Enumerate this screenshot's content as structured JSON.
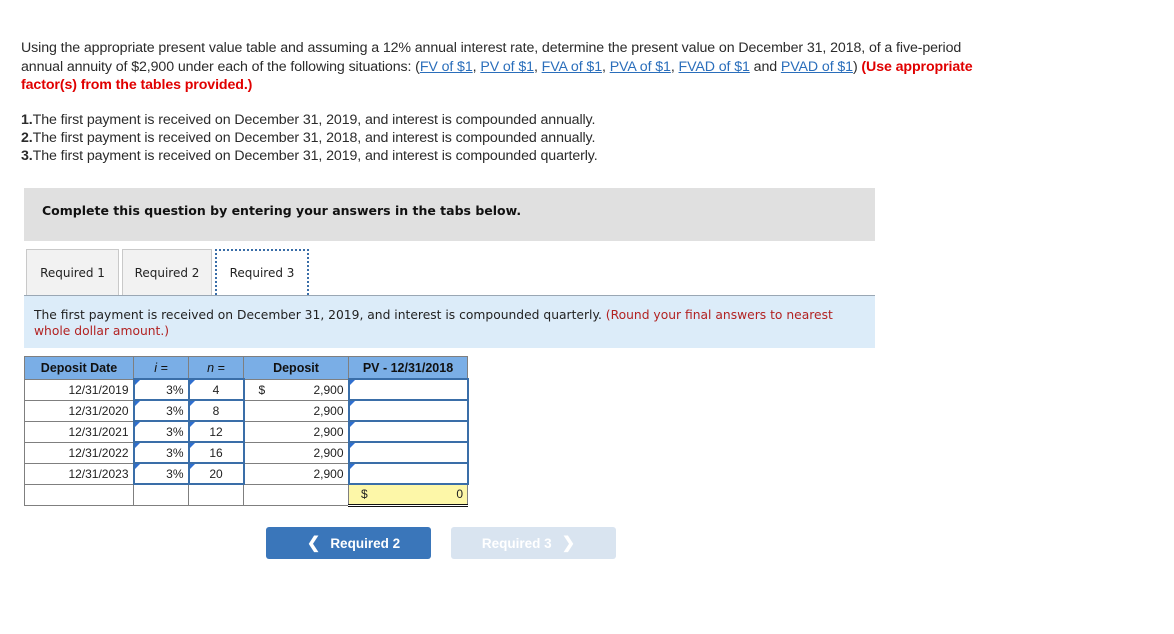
{
  "intro": {
    "text_before_links": "Using the appropriate present value table and assuming a 12% annual interest rate, determine the present value on December 31, 2018, of a five-period annual annuity of $2,900 under each of the following situations: (",
    "links": [
      "FV of $1",
      "PV of $1",
      "FVA of $1",
      "PVA of $1",
      "FVAD of $1",
      "PVAD of $1"
    ],
    "link_sep": ", ",
    "last_link_sep": " and ",
    "text_after_links": ")",
    "instruction": "(Use appropriate factor(s) from the tables provided.)"
  },
  "situations": [
    {
      "num": "1.",
      "text": "The first payment is received on December 31, 2019, and interest is compounded annually."
    },
    {
      "num": "2.",
      "text": "The first payment is received on December 31, 2018, and interest is compounded annually."
    },
    {
      "num": "3.",
      "text": "The first payment is received on December 31, 2019, and interest is compounded quarterly."
    }
  ],
  "banner": "Complete this question by entering your answers in the tabs below.",
  "tabs": [
    {
      "label": "Required 1",
      "active": false
    },
    {
      "label": "Required 2",
      "active": false
    },
    {
      "label": "Required 3",
      "active": true
    }
  ],
  "instruction_panel": {
    "text": "The first payment is received on December 31, 2019, and interest is compounded quarterly.",
    "note": "(Round your final answers to nearest whole dollar amount.)"
  },
  "table": {
    "headers": [
      "Deposit Date",
      "i =",
      "n =",
      "Deposit",
      "PV - 12/31/2018"
    ],
    "currency_symbol": "$",
    "rows": [
      {
        "date": "12/31/2019",
        "i": "3%",
        "n": "4",
        "deposit": "2,900",
        "pv": ""
      },
      {
        "date": "12/31/2020",
        "i": "3%",
        "n": "8",
        "deposit": "2,900",
        "pv": ""
      },
      {
        "date": "12/31/2021",
        "i": "3%",
        "n": "12",
        "deposit": "2,900",
        "pv": ""
      },
      {
        "date": "12/31/2022",
        "i": "3%",
        "n": "16",
        "deposit": "2,900",
        "pv": ""
      },
      {
        "date": "12/31/2023",
        "i": "3%",
        "n": "20",
        "deposit": "2,900",
        "pv": ""
      }
    ],
    "total": "0"
  },
  "nav": {
    "prev_label": "Required 2",
    "next_label": "Required 3",
    "next_enabled": false
  },
  "colors": {
    "link": "#2a6ebb",
    "accent_red": "#e00000",
    "header_blue": "#7aaee6",
    "total_yellow": "#fdf7a8",
    "primary_button": "#3a76ba",
    "disabled_button": "#d9e4f0"
  }
}
